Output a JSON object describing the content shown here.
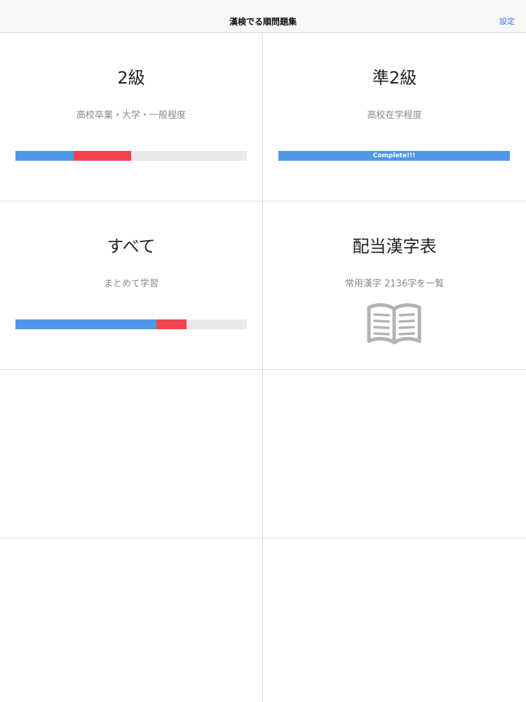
{
  "navbar": {
    "title": "漢検でる順問題集",
    "settings_label": "設定"
  },
  "cards": [
    {
      "title": "2級",
      "subtitle": "高校卒業・大学・一般程度",
      "progress": {
        "blue": 0.25,
        "red": 0.25,
        "complete": false
      }
    },
    {
      "title": "準2級",
      "subtitle": "高校在学程度",
      "progress": {
        "blue": 1.0,
        "red": 0.0,
        "complete": true
      },
      "complete_label": "Complete!!!"
    },
    {
      "title": "すべて",
      "subtitle": "まとめて学習",
      "progress": {
        "blue": 0.61,
        "red": 0.13,
        "complete": false
      }
    },
    {
      "title": "配当漢字表",
      "subtitle": "常用漢字 2136字を一覧",
      "icon": "open-book-icon"
    }
  ],
  "colors": {
    "progress_blue": "#5097ea",
    "progress_red": "#f0434f",
    "progress_track": "#e8e8e9",
    "accent": "#2f7fd6"
  }
}
